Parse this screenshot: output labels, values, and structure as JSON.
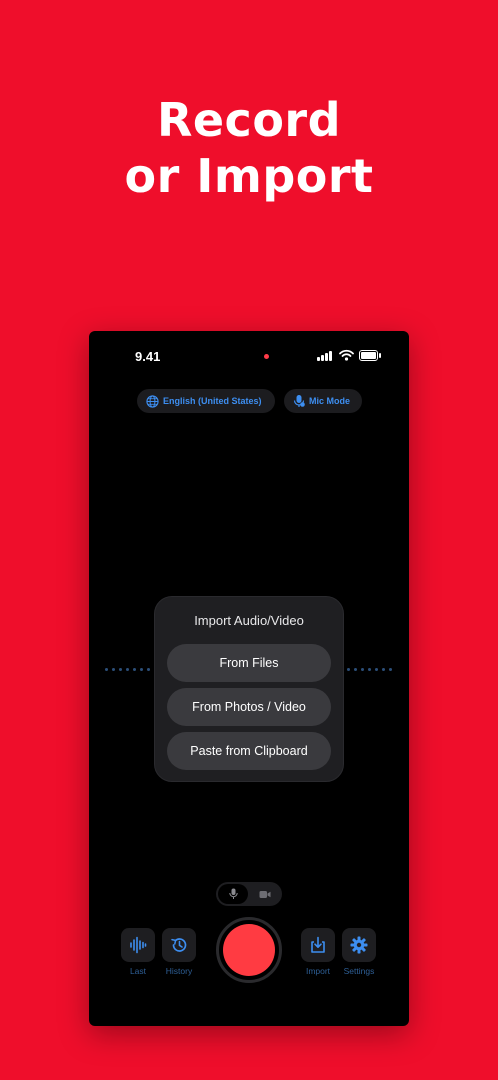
{
  "headline": {
    "line1": "Record",
    "line2": "or Import"
  },
  "status_bar": {
    "time": "9.41"
  },
  "chips": {
    "language": {
      "label": "English (United States)",
      "icon": "globe-icon"
    },
    "mode": {
      "label": "Mic Mode",
      "icon": "mic-icon"
    }
  },
  "import_menu": {
    "title": "Import Audio/Video",
    "options": [
      "From Files",
      "From Photos / Video",
      "Paste from Clipboard"
    ]
  },
  "mode_toggle": {
    "selected": "audio",
    "options": [
      "mic-icon",
      "video-camera-icon"
    ]
  },
  "bottom_bar": {
    "last_label": "Last",
    "history_label": "History",
    "import_label": "Import",
    "settings_label": "Settings"
  },
  "colors": {
    "background": "#ef0e2b",
    "accent": "#3d8ef0",
    "record": "#ff3b42",
    "label_muted": "#2e5f96"
  }
}
